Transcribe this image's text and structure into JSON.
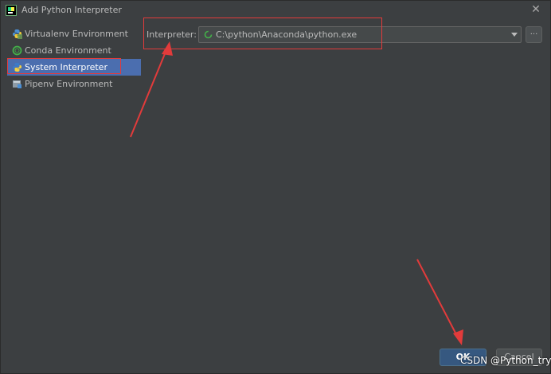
{
  "window": {
    "title": "Add Python Interpreter",
    "close_glyph": "✕"
  },
  "sidebar": {
    "items": [
      {
        "label": "Virtualenv Environment",
        "icon": "virtualenv-icon",
        "selected": false
      },
      {
        "label": "Conda Environment",
        "icon": "conda-icon",
        "selected": false
      },
      {
        "label": "System Interpreter",
        "icon": "python-icon",
        "selected": true
      },
      {
        "label": "Pipenv Environment",
        "icon": "pipenv-icon",
        "selected": false
      }
    ]
  },
  "main": {
    "interpreter_label": "Interpreter:",
    "interpreter_value": "C:\\python\\Anaconda\\python.exe",
    "browse_label": "..."
  },
  "footer": {
    "ok_label": "OK",
    "cancel_label": "Cancel"
  },
  "watermark": "CSDN @Python_try:",
  "colors": {
    "background": "#3c3f41",
    "selection": "#4b6eaf",
    "annotation_red": "#e23b3b",
    "ok_button": "#365880"
  }
}
